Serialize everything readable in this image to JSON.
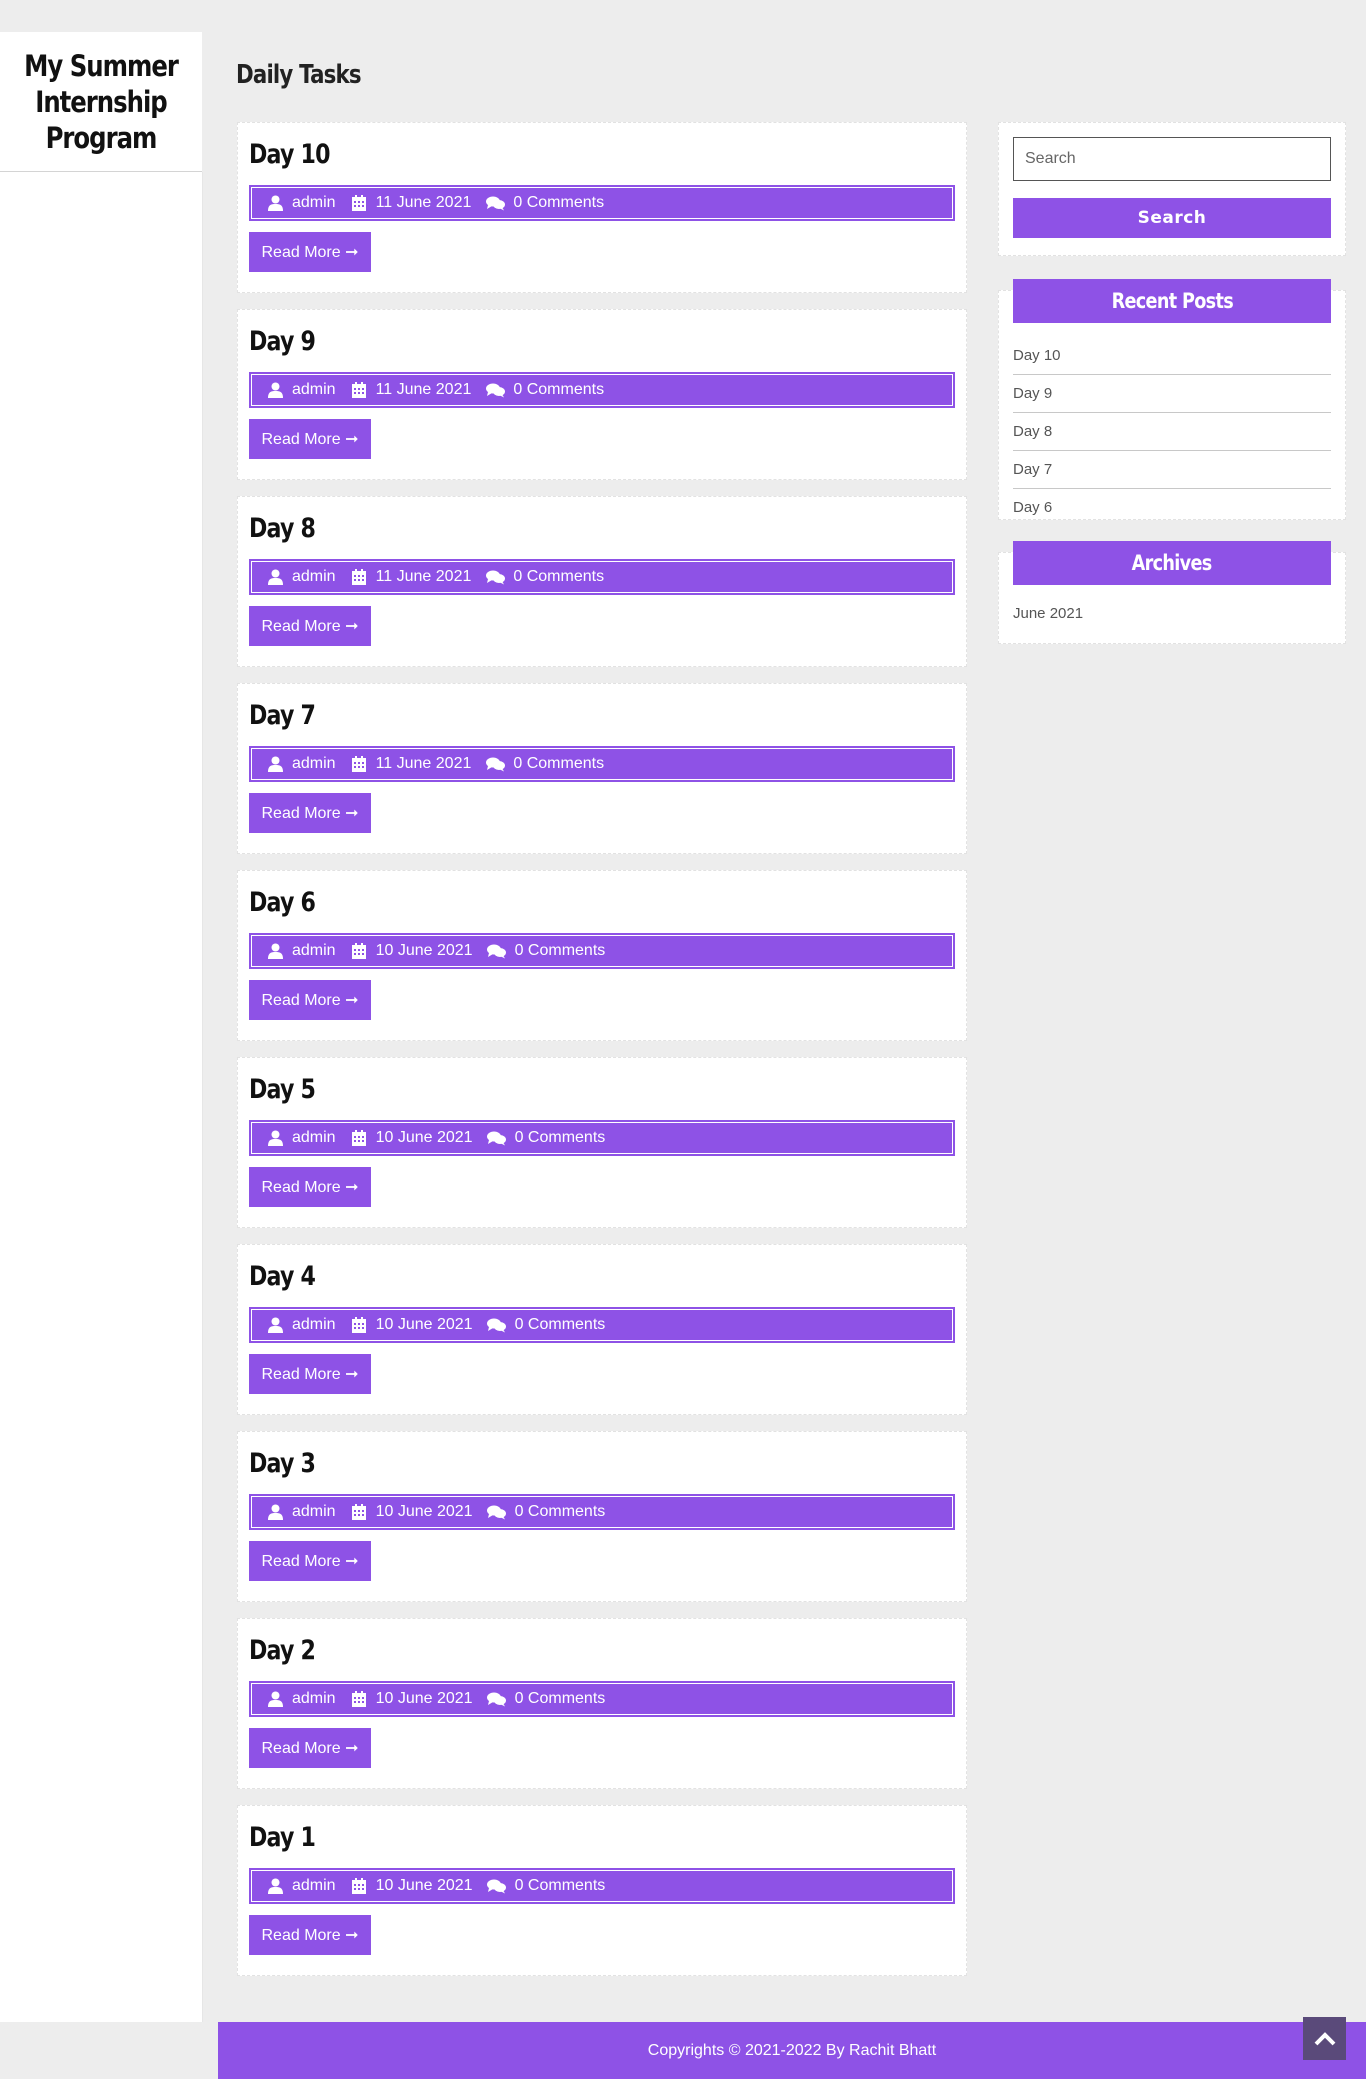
{
  "site": {
    "title": "My Summer Internship Program"
  },
  "page": {
    "heading": "Daily Tasks"
  },
  "posts": [
    {
      "title": "Day 10",
      "author": "admin",
      "date": "11 June 2021",
      "comments": "0 Comments",
      "read_more": "Read More ➞"
    },
    {
      "title": "Day 9",
      "author": "admin",
      "date": "11 June 2021",
      "comments": "0 Comments",
      "read_more": "Read More ➞"
    },
    {
      "title": "Day 8",
      "author": "admin",
      "date": "11 June 2021",
      "comments": "0 Comments",
      "read_more": "Read More ➞"
    },
    {
      "title": "Day 7",
      "author": "admin",
      "date": "11 June 2021",
      "comments": "0 Comments",
      "read_more": "Read More ➞"
    },
    {
      "title": "Day 6",
      "author": "admin",
      "date": "10 June 2021",
      "comments": "0 Comments",
      "read_more": "Read More ➞"
    },
    {
      "title": "Day 5",
      "author": "admin",
      "date": "10 June 2021",
      "comments": "0 Comments",
      "read_more": "Read More ➞"
    },
    {
      "title": "Day 4",
      "author": "admin",
      "date": "10 June 2021",
      "comments": "0 Comments",
      "read_more": "Read More ➞"
    },
    {
      "title": "Day 3",
      "author": "admin",
      "date": "10 June 2021",
      "comments": "0 Comments",
      "read_more": "Read More ➞"
    },
    {
      "title": "Day 2",
      "author": "admin",
      "date": "10 June 2021",
      "comments": "0 Comments",
      "read_more": "Read More ➞"
    },
    {
      "title": "Day 1",
      "author": "admin",
      "date": "10 June 2021",
      "comments": "0 Comments",
      "read_more": "Read More ➞"
    }
  ],
  "sidebar": {
    "search": {
      "placeholder": "Search",
      "button_label": "Search"
    },
    "recent_posts": {
      "title": "Recent Posts",
      "items": [
        "Day 10",
        "Day 9",
        "Day 8",
        "Day 7",
        "Day 6"
      ]
    },
    "archives": {
      "title": "Archives",
      "items": [
        "June 2021"
      ]
    }
  },
  "footer": {
    "text": "Copyrights © 2021-2022 By Rachit Bhatt"
  },
  "icons": {
    "author": "user-icon",
    "date": "calendar-icon",
    "comments": "comments-icon",
    "back_to_top": "chevron-up-icon"
  },
  "colors": {
    "accent": "#8e52e6",
    "background": "#ededed"
  }
}
